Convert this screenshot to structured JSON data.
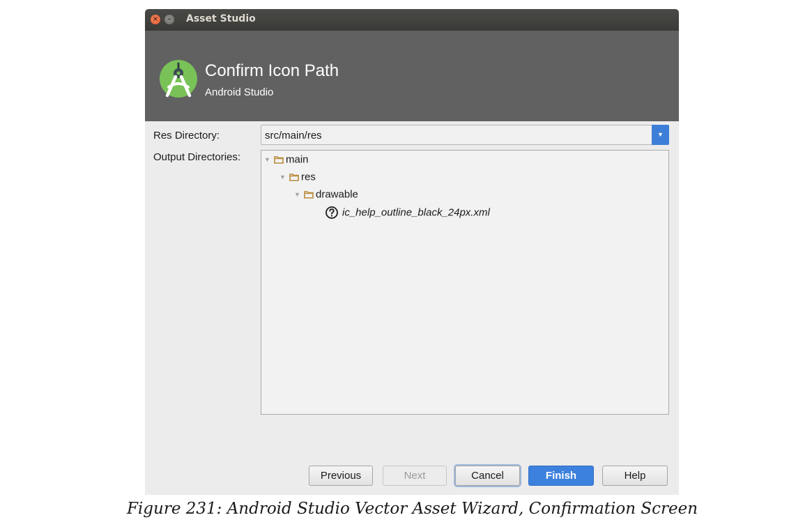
{
  "window": {
    "title": "Asset Studio",
    "close_glyph": "×",
    "minimize_glyph": "–"
  },
  "header": {
    "title": "Confirm Icon Path",
    "subtitle": "Android Studio",
    "logo_icon": "android-studio-logo-icon",
    "background_color": "#616161"
  },
  "form": {
    "res_directory_label": "Res Directory:",
    "res_directory_value": "src/main/res",
    "output_directories_label": "Output Directories:"
  },
  "tree": {
    "items": [
      {
        "label": "main",
        "icon": "folder-icon",
        "expanded": true,
        "level": 0
      },
      {
        "label": "res",
        "icon": "folder-icon",
        "expanded": true,
        "level": 1
      },
      {
        "label": "drawable",
        "icon": "folder-icon",
        "expanded": true,
        "level": 2
      },
      {
        "label": "ic_help_outline_black_24px.xml",
        "icon": "help-outline-icon",
        "expanded": false,
        "level": 3
      }
    ]
  },
  "buttons": {
    "previous": "Previous",
    "next": "Next",
    "cancel": "Cancel",
    "finish": "Finish",
    "help": "Help"
  },
  "colors": {
    "accent": "#3d81de",
    "folder": "#b88a3b",
    "logo_green": "#78c257"
  },
  "caption": "Figure 231: Android Studio Vector Asset Wizard, Confirmation Screen"
}
